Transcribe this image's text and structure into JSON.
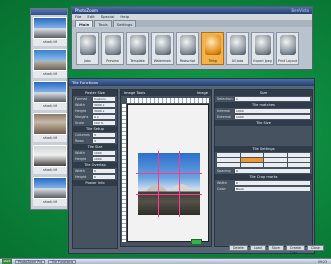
{
  "function_window": {
    "title": "PhotoZoom",
    "brand": "BenVista",
    "menu": [
      "File",
      "Edit",
      "Special",
      "Help"
    ],
    "tabs": [
      "Main",
      "Tools",
      "Settings"
    ],
    "tiles": [
      "Jobs",
      "Preview",
      "Template",
      "Watermark",
      "Postscript",
      "Tiling",
      "All Jobs",
      "Export Jpeg",
      "Print Layout"
    ]
  },
  "thumbnails": [
    "shark.tif",
    "shark.tif",
    "shark.tif",
    "shark.tif",
    "shark.tif",
    "shark.tif"
  ],
  "main_window": {
    "title": "Tile Functions",
    "left_panel": {
      "poster_size": "Poster Size",
      "fields": [
        {
          "k": "Format",
          "v": "Custom"
        },
        {
          "k": "Width",
          "v": "3000 x"
        },
        {
          "k": "Height",
          "v": "3000 x"
        },
        {
          "k": "Margins",
          "v": "0 x"
        },
        {
          "k": "Scale",
          "v": "100 %"
        }
      ],
      "tile_setup": "Tile Setup",
      "setup_fields": [
        {
          "k": "Columns",
          "v": "3"
        },
        {
          "k": "Rows",
          "v": "3"
        }
      ],
      "tile_size": "Tile Size",
      "size_fields": [
        {
          "k": "Width",
          "v": "1000"
        },
        {
          "k": "Height",
          "v": "1000"
        }
      ],
      "tile_overlap": "Tile Overlap",
      "overlap_fields": [
        {
          "k": "Width",
          "v": "0"
        },
        {
          "k": "Height",
          "v": "0"
        }
      ],
      "poster_info": "Poster Info"
    },
    "image_panel": {
      "label_image_tools": "Image Tools",
      "label_image": "Image"
    },
    "right_panel": {
      "size_label": "Size",
      "tile_matches": "Tile matches",
      "tile_size": "Tile Size",
      "tile_settings": "Tile Settings",
      "tile_crop_marks": "Tile Crop marks",
      "fields": [
        {
          "k": "Selection",
          "v": "1"
        },
        {
          "k": "Internal",
          "v": "1000"
        },
        {
          "k": "External",
          "v": "1000"
        },
        {
          "k": "Spacing",
          "v": "0"
        },
        {
          "k": "Width",
          "v": "0"
        },
        {
          "k": "Color",
          "v": "Black"
        }
      ]
    },
    "bottom_buttons": [
      "Delete",
      "Load",
      "Save",
      "Create Tiles",
      "Close"
    ]
  },
  "taskbar": {
    "start_label": "start",
    "tasks": [
      "PhotoZoom Pro",
      "Tile Functions"
    ],
    "clock": "09:23"
  }
}
